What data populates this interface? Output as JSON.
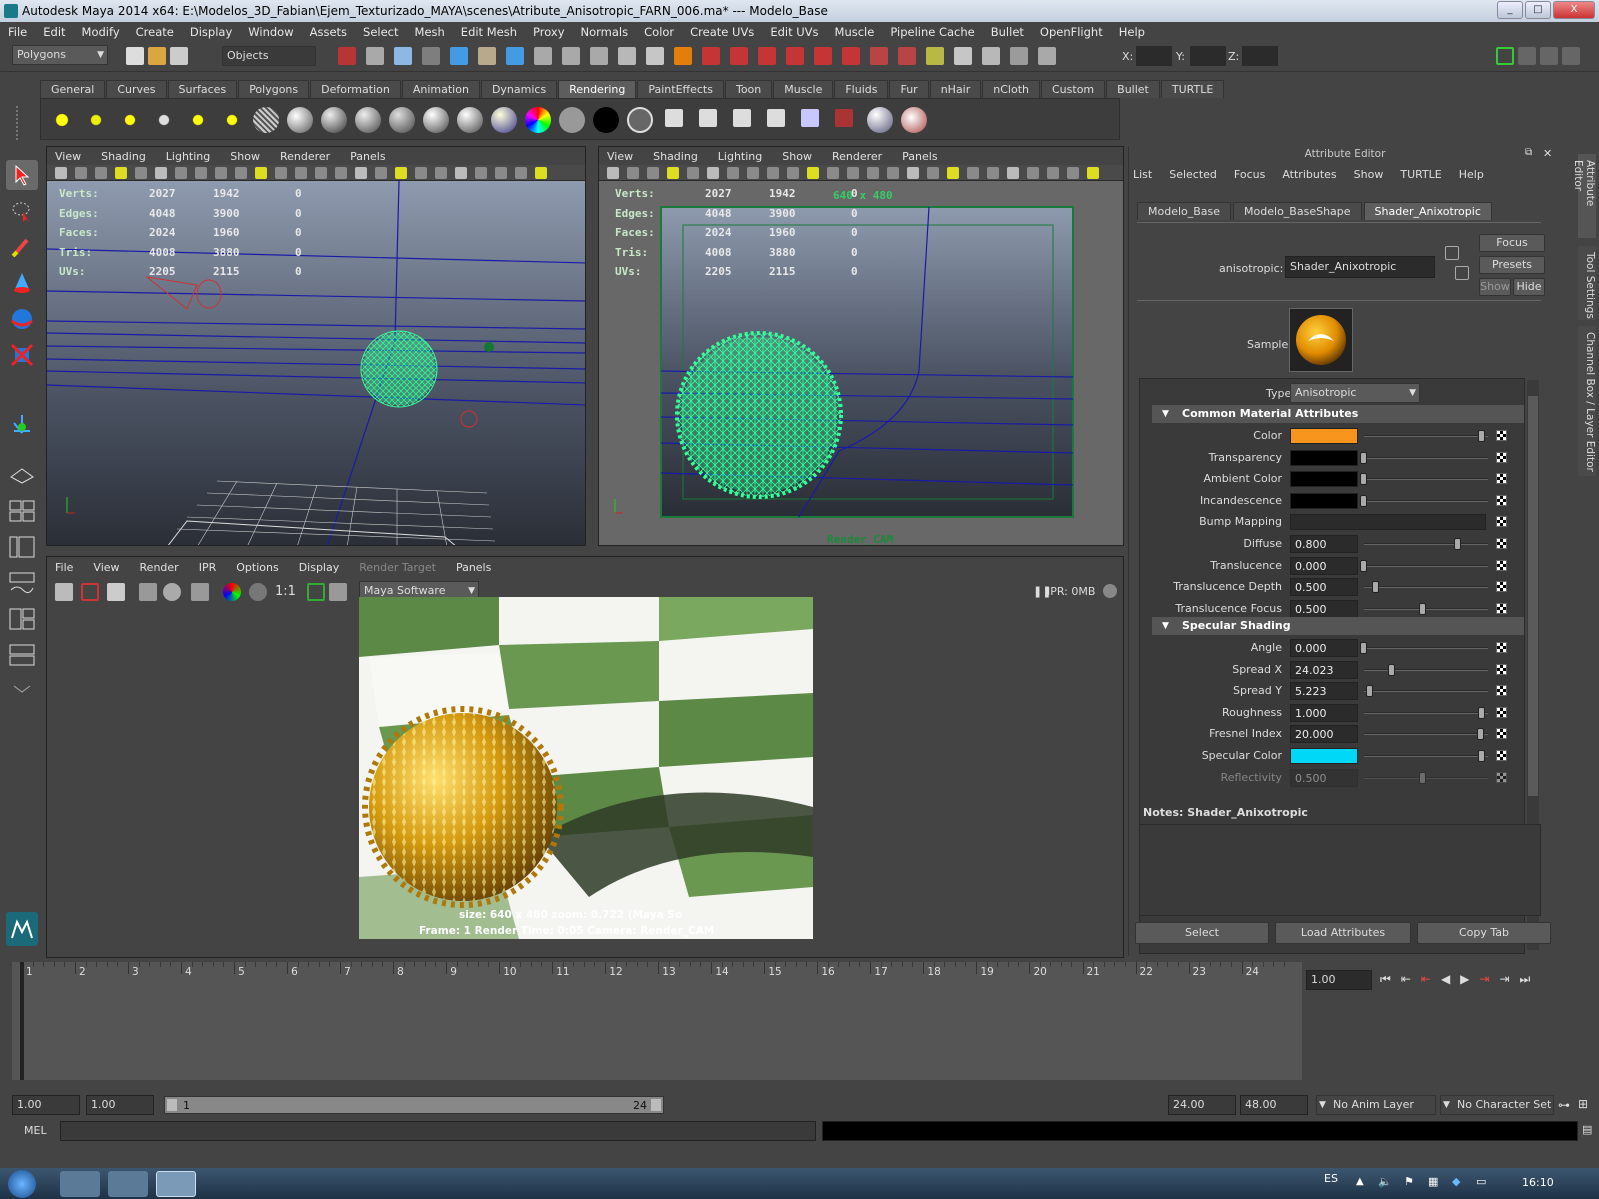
{
  "window": {
    "title": "Autodesk Maya 2014 x64: E:\\Modelos_3D_Fabian\\Ejem_Texturizado_MAYA\\scenes\\Atribute_Anisotropic_FARN_006.ma*   ---   Modelo_Base",
    "min": "_",
    "max": "□",
    "close": "X"
  },
  "menus": [
    "File",
    "Edit",
    "Modify",
    "Create",
    "Display",
    "Window",
    "Assets",
    "Select",
    "Mesh",
    "Edit Mesh",
    "Proxy",
    "Normals",
    "Color",
    "Create UVs",
    "Edit UVs",
    "Muscle",
    "Pipeline Cache",
    "Bullet",
    "OpenFlight",
    "Help"
  ],
  "statusline": {
    "mode": "Polygons",
    "selectmode": "Objects",
    "x_label": "X:",
    "y_label": "Y:",
    "z_label": "Z:"
  },
  "shelf_tabs": [
    "General",
    "Curves",
    "Surfaces",
    "Polygons",
    "Deformation",
    "Animation",
    "Dynamics",
    "Rendering",
    "PaintEffects",
    "Toon",
    "Muscle",
    "Fluids",
    "Fur",
    "nHair",
    "nCloth",
    "Custom",
    "Bullet",
    "TURTLE"
  ],
  "shelf_active": "Rendering",
  "viewport_menu": [
    "View",
    "Shading",
    "Lighting",
    "Show",
    "Renderer",
    "Panels"
  ],
  "hud": {
    "rows": [
      {
        "label": "Verts:",
        "a": "2027",
        "b": "1942",
        "c": "0"
      },
      {
        "label": "Edges:",
        "a": "4048",
        "b": "3900",
        "c": "0"
      },
      {
        "label": "Faces:",
        "a": "2024",
        "b": "1960",
        "c": "0"
      },
      {
        "label": "Tris:",
        "a": "4008",
        "b": "3880",
        "c": "0"
      },
      {
        "label": "UVs:",
        "a": "2205",
        "b": "2115",
        "c": "0"
      }
    ],
    "resolution": "640 x 480",
    "camera": "Render_CAM"
  },
  "renderview": {
    "menu": [
      "File",
      "View",
      "Render",
      "IPR",
      "Options",
      "Display",
      "Render Target",
      "Panels"
    ],
    "ratio": "1:1",
    "renderer": "Maya Software",
    "ipr": "IPR: 0MB",
    "info1": "size: 640 x 480 zoom: 0.722      (Maya So",
    "info2": "Frame: 1      Render Time: 0:05      Camera: Render_CAM"
  },
  "attribute_editor": {
    "title": "Attribute Editor",
    "menu": [
      "List",
      "Selected",
      "Focus",
      "Attributes",
      "Show",
      "TURTLE",
      "Help"
    ],
    "tabs": [
      "Modelo_Base",
      "Modelo_BaseShape",
      "Shader_Anixotropic"
    ],
    "active_tab": "Shader_Anixotropic",
    "node_label": "anisotropic:",
    "node_name": "Shader_Anixotropic",
    "focus": "Focus",
    "presets": "Presets",
    "show": "Show",
    "hide": "Hide",
    "sample_label": "Sample",
    "type_label": "Type",
    "type_value": "Anisotropic",
    "section1": "Common Material Attributes",
    "section2": "Specular Shading",
    "notes": "Notes:  Shader_Anixotropic",
    "btn_select": "Select",
    "btn_load": "Load Attributes",
    "btn_copy": "Copy Tab",
    "side_tabs": [
      "Attribute Editor",
      "Tool Settings",
      "Channel Box / Layer Editor"
    ]
  },
  "common_attrs": [
    {
      "label": "Color",
      "swatch": "#f7951c",
      "knob": 1.0
    },
    {
      "label": "Transparency",
      "swatch": "#000000",
      "knob": 0.0
    },
    {
      "label": "Ambient Color",
      "swatch": "#000000",
      "knob": 0.0
    },
    {
      "label": "Incandescence",
      "swatch": "#000000",
      "knob": 0.0
    },
    {
      "label": "Bump Mapping",
      "wide": true
    },
    {
      "label": "Diffuse",
      "value": "0.800",
      "knob": 0.8
    },
    {
      "label": "Translucence",
      "value": "0.000",
      "knob": 0.0
    },
    {
      "label": "Translucence Depth",
      "value": "0.500",
      "knob": 0.1
    },
    {
      "label": "Translucence Focus",
      "value": "0.500",
      "knob": 0.5
    }
  ],
  "spec_attrs": [
    {
      "label": "Angle",
      "value": "0.000",
      "knob": 0.0
    },
    {
      "label": "Spread X",
      "value": "24.023",
      "knob": 0.24
    },
    {
      "label": "Spread Y",
      "value": "5.223",
      "knob": 0.05
    },
    {
      "label": "Roughness",
      "value": "1.000",
      "knob": 1.0
    },
    {
      "label": "Fresnel Index",
      "value": "20.000",
      "knob": 0.99
    },
    {
      "label": "Specular Color",
      "swatch": "#00d8f8",
      "knob": 1.0
    },
    {
      "label": "Reflectivity",
      "value": "0.500",
      "knob": 0.5,
      "dim": true
    }
  ],
  "timeline": {
    "frames": [
      "1",
      "2",
      "3",
      "4",
      "5",
      "6",
      "7",
      "8",
      "9",
      "10",
      "11",
      "12",
      "13",
      "14",
      "15",
      "16",
      "17",
      "18",
      "19",
      "20",
      "21",
      "22",
      "23",
      "24"
    ],
    "current": "1.00"
  },
  "range": {
    "start1": "1.00",
    "start2": "1.00",
    "slider_start": "1",
    "slider_end": "24",
    "end1": "24.00",
    "end2": "48.00",
    "anim_layer": "No Anim Layer",
    "char_set": "No Character Set"
  },
  "mel": {
    "label": "MEL"
  },
  "taskbar": {
    "lang": "ES",
    "time": "16:10"
  }
}
